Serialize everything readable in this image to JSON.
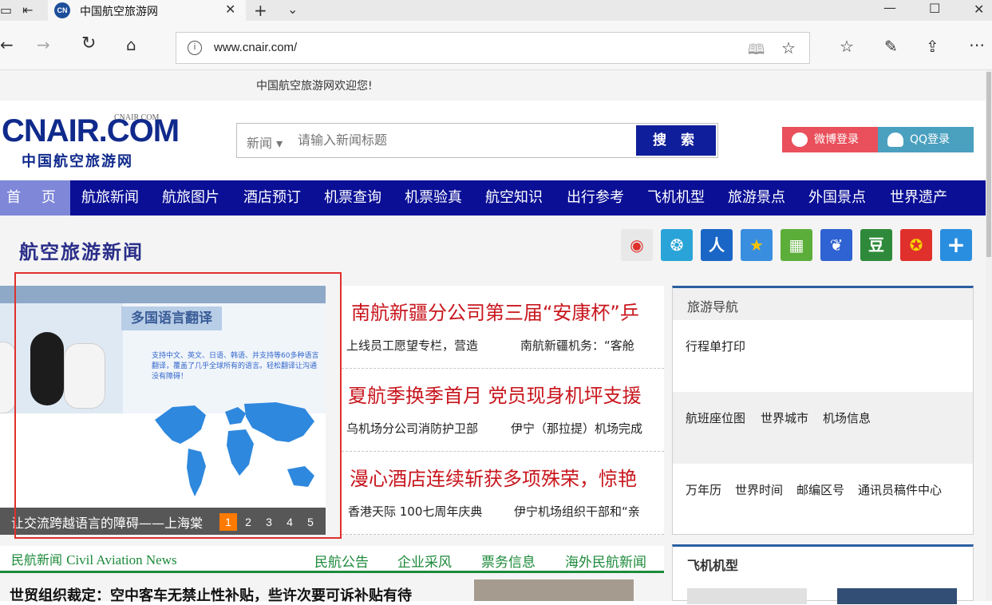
{
  "browser": {
    "tab_favicon": "CN",
    "tab_title": "中国航空旅游网",
    "url": "www.cnair.com/",
    "icons": [
      "back-icon",
      "forward-icon",
      "refresh-icon",
      "home-icon",
      "info-icon",
      "reading-view-icon",
      "favorite-star-icon",
      "favorites-list-icon",
      "pen-icon",
      "share-icon",
      "more-icon",
      "minimize-icon",
      "maximize-icon",
      "close-icon"
    ]
  },
  "site": {
    "welcome": "中国航空旅游网欢迎您!",
    "logo_main": "CNAIR.COM",
    "logo_small": "CNAIR.COM",
    "logo_sub": "中国航空旅游网",
    "search": {
      "category": "新闻",
      "placeholder": "请输入新闻标题",
      "button": "搜 索"
    },
    "weibo_login": "微博登录",
    "qq_login": "QQ登录",
    "nav": {
      "home": "首 页",
      "items": [
        "航旅新闻",
        "航旅图片",
        "酒店预订",
        "机票查询",
        "机票验真",
        "航空知识",
        "出行参考",
        "飞机机型",
        "旅游景点",
        "外国景点",
        "世界遗产"
      ]
    },
    "section_title": "航空旅游新闻",
    "share_icons": [
      "weibo-share-icon",
      "tencent-share-icon",
      "renren-share-icon",
      "qzone-share-icon",
      "kaixin-share-icon",
      "baidu-share-icon",
      "douban-share-icon",
      "pengyou-share-icon",
      "more-share-icon"
    ],
    "slider": {
      "ribbon": "多国语言翻译",
      "desc": "支持中文、英文、日语、韩语、并支持等60多种语言翻译，覆盖了几乎全球所有的语言。轻松翻译让沟通没有障碍！",
      "caption": "让交流跨越语言的障碍——上海棠",
      "pages": [
        "1",
        "2",
        "3",
        "4",
        "5"
      ],
      "active_page": "1"
    },
    "headlines": [
      {
        "title": "南航新疆分公司第三届“安康杯”乒",
        "subs": [
          "上线员工愿望专栏，营造",
          "南航新疆机务：“客舱"
        ]
      },
      {
        "title": "夏航季换季首月 党员现身机坪支援",
        "subs": [
          "乌机场分公司消防护卫部",
          "伊宁（那拉提）机场完成"
        ]
      },
      {
        "title": "漫心酒店连续斩获多项殊荣，惊艳",
        "subs": [
          "香港天际 100七周年庆典",
          "伊宁机场组织干部和“亲"
        ]
      }
    ],
    "tourism": {
      "title": "旅游导航",
      "row1": [
        "行程单打印"
      ],
      "row2": [
        "航班座位图",
        "世界城市",
        "机场信息"
      ],
      "row3": [
        "万年历",
        "世界时间",
        "邮编区号",
        "通讯员稿件中心"
      ]
    },
    "civil": {
      "lead_cn": "民航新闻",
      "lead_en": "Civil Aviation News",
      "links": [
        "民航公告",
        "企业采风",
        "票务信息",
        "海外民航新闻"
      ]
    },
    "news_line": "世贸组织裁定：空中客车无禁止性补贴，些许次要可诉补贴有待",
    "planes_title": "飞机机型",
    "colors": {
      "nav_bg": "#0b0f95",
      "headline_red": "#c8161d",
      "civil_green": "#1c8a3a",
      "active_dot": "#ff7a00",
      "highlight_box": "#e0302c"
    }
  }
}
